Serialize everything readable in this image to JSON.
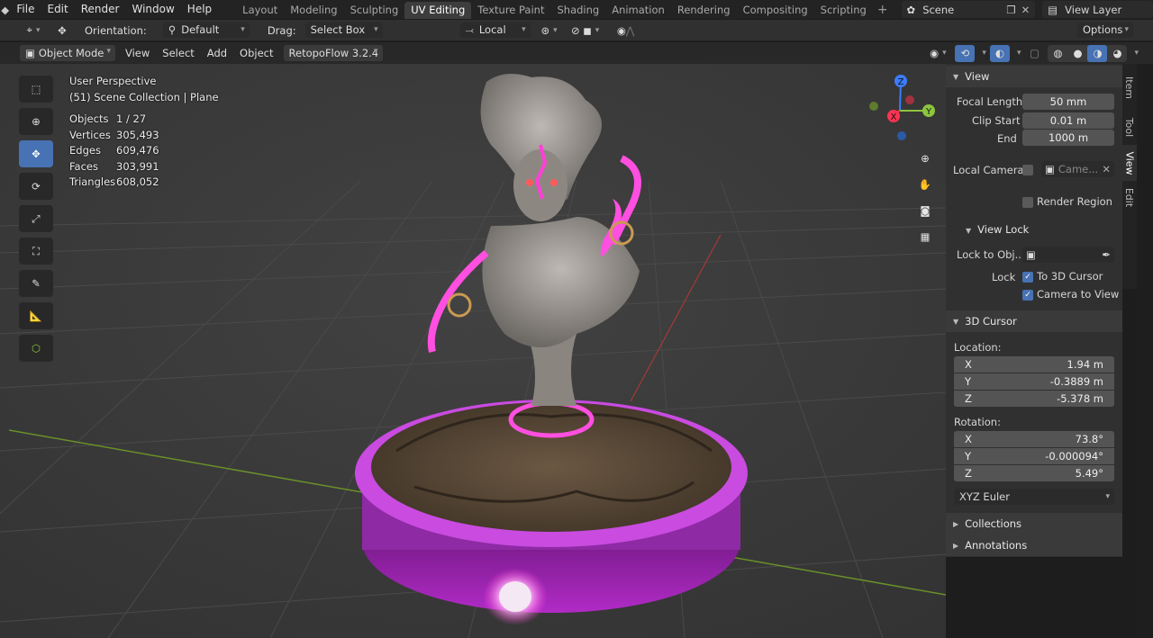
{
  "menu": {
    "file": "File",
    "edit": "Edit",
    "render": "Render",
    "window": "Window",
    "help": "Help"
  },
  "workspaces": [
    "Layout",
    "Modeling",
    "Sculpting",
    "UV Editing",
    "Texture Paint",
    "Shading",
    "Animation",
    "Rendering",
    "Compositing",
    "Scripting"
  ],
  "active_workspace_index": 3,
  "scene": {
    "label": "Scene",
    "view_layer": "View Layer"
  },
  "tool_header": {
    "orientation_label": "Orientation:",
    "orientation_value": "Default",
    "drag_label": "Drag:",
    "drag_value": "Select Box",
    "pivot": "Local",
    "options": "Options"
  },
  "viewport_header": {
    "mode": "Object Mode",
    "view": "View",
    "select": "Select",
    "add": "Add",
    "object": "Object",
    "addon": "RetopoFlow 3.2.4"
  },
  "overlay": {
    "perspective": "User Perspective",
    "collection": "(51) Scene Collection | Plane",
    "stats": [
      {
        "label": "Objects",
        "value": "1 / 27"
      },
      {
        "label": "Vertices",
        "value": "305,493"
      },
      {
        "label": "Edges",
        "value": "609,476"
      },
      {
        "label": "Faces",
        "value": "303,991"
      },
      {
        "label": "Triangles",
        "value": "608,052"
      }
    ]
  },
  "gizmo": {
    "x": "X",
    "y": "Y",
    "z": "Z"
  },
  "panel": {
    "view": {
      "title": "View",
      "focal_length_label": "Focal Length",
      "focal_length": "50 mm",
      "clip_start_label": "Clip Start",
      "clip_start": "0.01 m",
      "end_label": "End",
      "end": "1000 m",
      "local_camera_label": "Local Camera",
      "camera_placeholder": "Came...",
      "render_region": "Render Region"
    },
    "view_lock": {
      "title": "View Lock",
      "lock_to_object": "Lock to Obj...",
      "lock_label": "Lock",
      "to_3d_cursor": "To 3D Cursor",
      "camera_to_view": "Camera to View"
    },
    "cursor": {
      "title": "3D Cursor",
      "location_label": "Location:",
      "loc_x": "1.94 m",
      "loc_y": "-0.3889 m",
      "loc_z": "-5.378 m",
      "rotation_label": "Rotation:",
      "rot_x": "73.8°",
      "rot_y": "-0.000094°",
      "rot_z": "5.49°",
      "rot_mode": "XYZ Euler"
    },
    "collections": "Collections",
    "annotations": "Annotations"
  },
  "side_tabs": [
    "Item",
    "Tool",
    "View",
    "Edit"
  ],
  "colors": {
    "accent": "#4772b3",
    "glow": "#ff3fd6",
    "panel": "#303030",
    "viewport": "#393939"
  }
}
